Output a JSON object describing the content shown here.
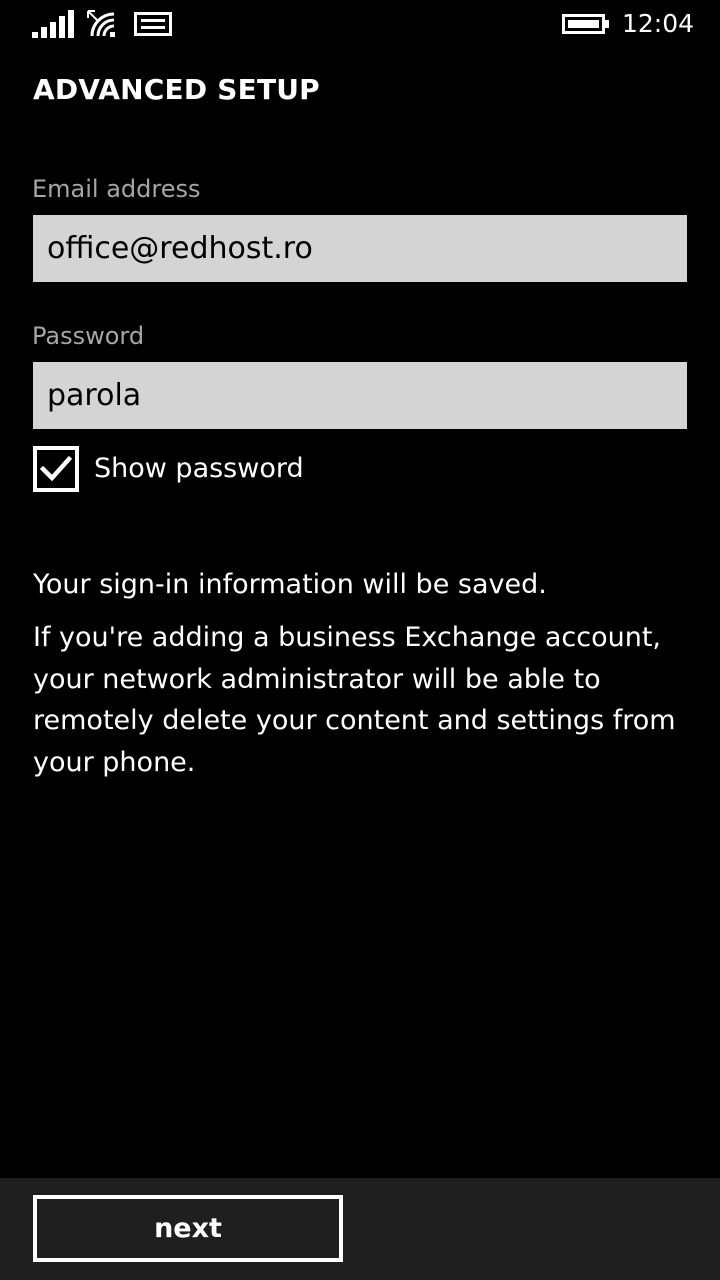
{
  "status_bar": {
    "time": "12:04",
    "icons": [
      "signal-icon",
      "wifi-icon",
      "message-icon",
      "battery-icon"
    ]
  },
  "page": {
    "title": "ADVANCED SETUP"
  },
  "form": {
    "email_label": "Email address",
    "email_value": "office@redhost.ro",
    "password_label": "Password",
    "password_value": "parola",
    "show_password_label": "Show password",
    "show_password_checked": true
  },
  "info": {
    "saved_text": "Your sign-in information will be saved.",
    "exchange_text": "If you're adding a business Exchange account, your network administrator will be able to remotely delete your content and settings from your phone."
  },
  "app_bar": {
    "next_label": "next"
  },
  "colors": {
    "background": "#000000",
    "text": "#ffffff",
    "label": "#a6a6a6",
    "input_background": "#d4d4d4",
    "app_bar_background": "#1f1f1f"
  }
}
